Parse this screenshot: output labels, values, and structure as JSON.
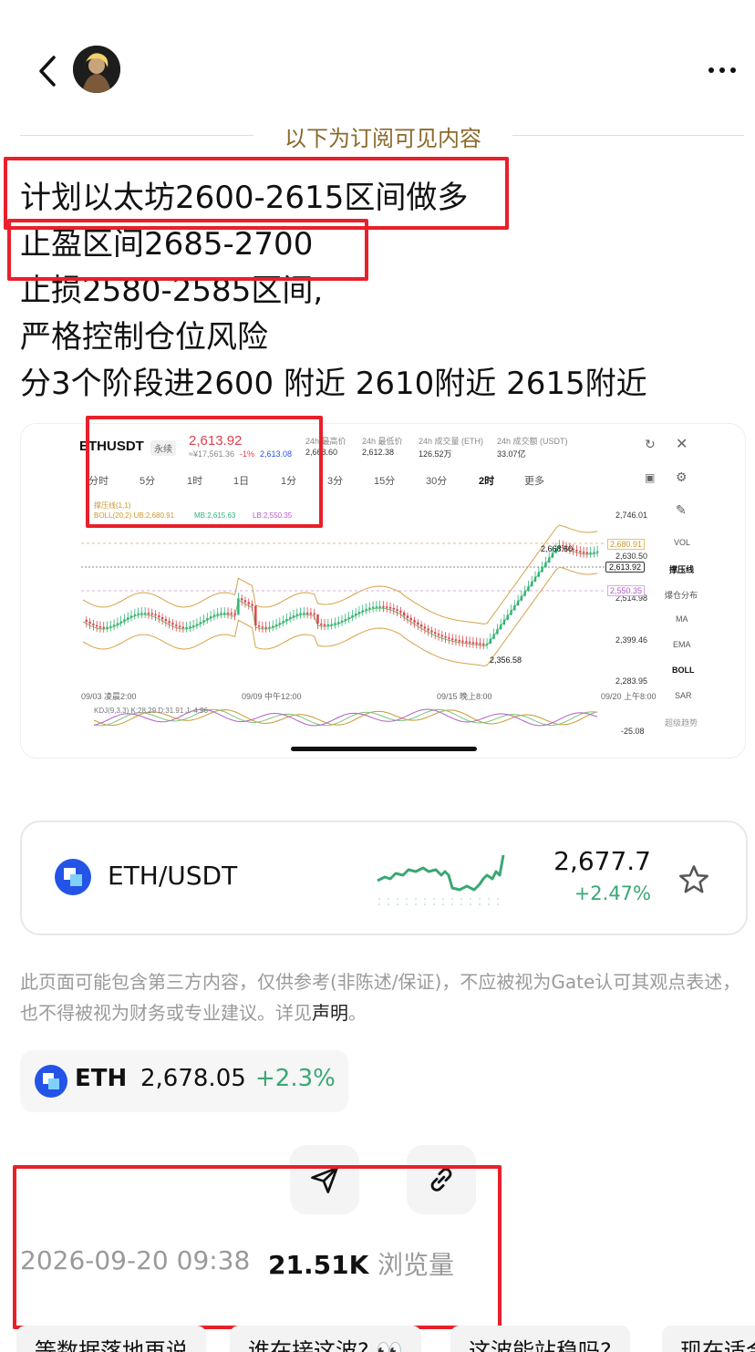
{
  "header": {
    "back_icon": "chevron-left-icon",
    "more_icon": "more-dots-icon"
  },
  "subscription_label": "以下为订阅可见内容",
  "post_lines": [
    "计划以太坊2600-2615区间做多",
    "止盈区间2685-2700",
    "止损2580-2585区间,",
    "严格控制仓位风险",
    "分3个阶段进2600 附近 2610附近 2615附近"
  ],
  "chart_image": {
    "symbol": "ETHUSDT",
    "contract": "永续",
    "price": "2,613.92",
    "cny": "≈¥17,561.36",
    "change": "-1%",
    "mark": "2,613.08",
    "stats": [
      {
        "label": "24h 最高价",
        "value": "2,668.60"
      },
      {
        "label": "24h 最低价",
        "value": "2,612.38"
      },
      {
        "label": "24h 成交量 (ETH)",
        "value": "126.52万"
      },
      {
        "label": "24h 成交额 (USDT)",
        "value": "33.07亿"
      }
    ],
    "intervals": [
      "分时",
      "5分",
      "1时",
      "1日",
      "1分",
      "3分",
      "15分",
      "30分",
      "2时",
      "更多"
    ],
    "active_interval": "2时",
    "indicator_title": "撑压线(1,1)",
    "boll": "BOLL(20,2) UB:2,680.91",
    "boll_mb": "MB:2,615.63",
    "boll_lb": "LB:2,550.35",
    "y_ticks": [
      "2,746.01",
      "2,630.50",
      "2,514.98",
      "2,399.46",
      "2,283.95"
    ],
    "price_tags": [
      "2,680.91",
      "2,613.92",
      "2,550.35"
    ],
    "high_label": "2,668.60",
    "low_label": "2,356.58",
    "x_ticks": [
      "09/03 凌晨2:00",
      "09/09 中午12:00",
      "09/15 晚上8:00",
      "09/20 上午8:00"
    ],
    "kdj": "KDJ(9,3,3)  K:28.29  D:31.91  J:-4.96",
    "kdj_tick": "-25.08",
    "side_tools": [
      "VOL",
      "撑压线",
      "爆仓分布",
      "MA",
      "EMA",
      "BOLL",
      "SAR",
      "超级趋势"
    ],
    "colors": {
      "up": "#2fb37a",
      "down": "#e0404a",
      "band": "#d8a24a"
    }
  },
  "market": {
    "pair": "ETH/USDT",
    "price": "2,677.7",
    "change": "+2.47%",
    "star_icon": "star-outline-icon",
    "up_color": "#2fb37a"
  },
  "disclaimer": {
    "text": "此页面可能包含第三方内容，仅供参考(非陈述/保证)，不应被视为Gate认可其观点表述，也不得被视为财务或专业建议。详见",
    "link": "声明",
    "end": "。"
  },
  "token_chip": {
    "symbol": "ETH",
    "price": "2,678.05",
    "change": "+2.3%"
  },
  "actions": {
    "share_icon": "send-icon",
    "link_icon": "link-icon"
  },
  "footer": {
    "date": "2026-09-20 09:38",
    "views": "21.51K",
    "views_label": "浏览量"
  },
  "tags": [
    "等数据落地再说",
    "谁在接这波? 👀",
    "这波能站稳吗?",
    "现在适合"
  ]
}
